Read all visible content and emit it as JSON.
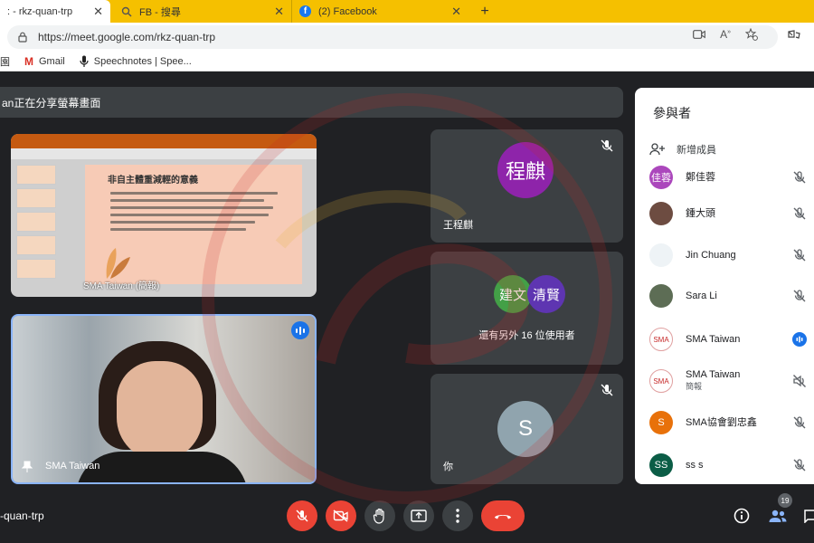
{
  "browser": {
    "tabs": [
      {
        "label": ": - rkz-quan-trp"
      },
      {
        "label": "FB - 搜尋"
      },
      {
        "label": "(2) Facebook"
      }
    ],
    "new_tab": "+",
    "url": "https://meet.google.com/rkz-quan-trp",
    "bookmarks": [
      {
        "label": "園"
      },
      {
        "label": "Gmail"
      },
      {
        "label": "Speechnotes | Spee..."
      }
    ]
  },
  "meet": {
    "presenting_banner": "an正在分享螢幕畫面",
    "presentation": {
      "slide_title": "非自主體重減輕的意義",
      "presenter_name": "SMA Taiwan (簡報)"
    },
    "camera_tile": {
      "name": "SMA Taiwan"
    },
    "tiles": [
      {
        "initials": "程麒",
        "name": "王程麒",
        "color": "#8e24aa"
      },
      {
        "initials_a": "建文",
        "initials_b": "清賢",
        "color_a": "#43a047",
        "color_b": "#5e35b1",
        "others": "還有另外 16 位使用者"
      },
      {
        "initials": "S",
        "name": "你",
        "color": "#90a4ae"
      }
    ],
    "meeting_code": "-quan-trp",
    "people_count": "19"
  },
  "participants": {
    "title": "參與者",
    "add_label": "新增成員",
    "list": [
      {
        "name": "鄭佳蓉",
        "initial": "佳蓉",
        "color": "#ab47bc",
        "status": "muted"
      },
      {
        "name": "鍾大頭",
        "initial": "",
        "color": "#6d4c41",
        "status": "muted"
      },
      {
        "name": "Jin Chuang",
        "initial": "",
        "color": "#cfd8dc",
        "status": "muted"
      },
      {
        "name": "Sara Li",
        "initial": "",
        "color": "#5d6d55",
        "status": "muted"
      },
      {
        "name": "SMA Taiwan",
        "initial": "SMA",
        "color": "#ffffff",
        "status": "speaking"
      },
      {
        "name": "SMA Taiwan",
        "sub": "簡報",
        "initial": "SMA",
        "color": "#ffffff",
        "status": "audio-off"
      },
      {
        "name": "SMA協會劉忠鑫",
        "initial": "S",
        "color": "#e8710a",
        "status": "muted"
      },
      {
        "name": "ss s",
        "initial": "SS",
        "color": "#0b5d46",
        "status": "muted"
      }
    ]
  },
  "colors": {
    "tab_strip": "#f5c000",
    "meet_bg": "#202124",
    "tile_bg": "#3c4043",
    "red": "#ea4335",
    "blue": "#1a73e8"
  },
  "watermark": {
    "text": "台灣脊髓肌肉萎縮症病友協會",
    "brand": "SMA",
    "sub": "TAIWAN"
  }
}
